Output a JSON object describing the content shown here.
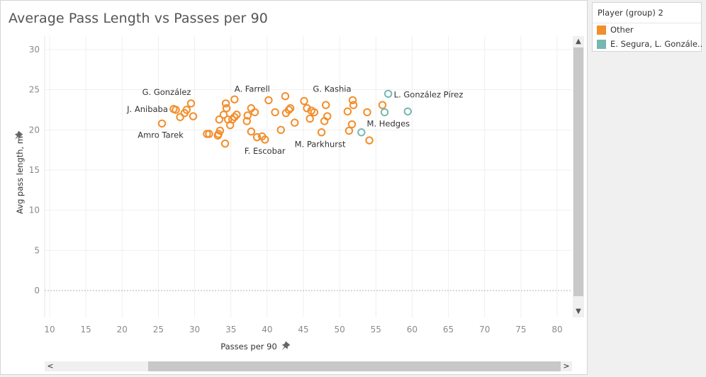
{
  "chart_data": {
    "type": "scatter",
    "title": "Average Pass Length vs Passes per 90",
    "xlabel": "Passes per 90",
    "ylabel": "Avg pass length, m",
    "xlim": [
      9,
      82
    ],
    "ylim": [
      -2,
      32
    ],
    "xticks": [
      10,
      15,
      20,
      25,
      30,
      35,
      40,
      45,
      50,
      55,
      60,
      65,
      70,
      75,
      80
    ],
    "yticks": [
      0,
      5,
      10,
      15,
      20,
      25,
      30
    ],
    "grid": true,
    "zero_line": "dotted",
    "legend": {
      "title": "Player (group) 2",
      "placement": "right",
      "entries": [
        {
          "name": "Other",
          "color": "#f28e2b"
        },
        {
          "name": "E. Segura, L. Gonzále..",
          "color": "#76b7b2"
        }
      ]
    },
    "series": [
      {
        "name": "Other",
        "color": "#f28e2b",
        "points": [
          {
            "x": 25.5,
            "y": 20.8,
            "label": "Amro Tarek"
          },
          {
            "x": 27.1,
            "y": 22.6
          },
          {
            "x": 27.4,
            "y": 22.5,
            "label": "J. Anibaba"
          },
          {
            "x": 28.0,
            "y": 21.6
          },
          {
            "x": 28.6,
            "y": 22.1
          },
          {
            "x": 28.9,
            "y": 22.5
          },
          {
            "x": 29.5,
            "y": 23.3,
            "label": "G. González"
          },
          {
            "x": 29.8,
            "y": 21.7
          },
          {
            "x": 31.7,
            "y": 19.5
          },
          {
            "x": 32.0,
            "y": 19.5
          },
          {
            "x": 33.2,
            "y": 19.3
          },
          {
            "x": 33.3,
            "y": 19.5
          },
          {
            "x": 33.5,
            "y": 19.9
          },
          {
            "x": 33.4,
            "y": 21.3
          },
          {
            "x": 34.0,
            "y": 21.9
          },
          {
            "x": 34.3,
            "y": 23.3
          },
          {
            "x": 34.4,
            "y": 22.7
          },
          {
            "x": 34.2,
            "y": 18.3
          },
          {
            "x": 34.6,
            "y": 21.3
          },
          {
            "x": 34.9,
            "y": 20.6
          },
          {
            "x": 35.2,
            "y": 21.3
          },
          {
            "x": 35.5,
            "y": 21.6
          },
          {
            "x": 35.8,
            "y": 21.9
          },
          {
            "x": 35.5,
            "y": 23.8,
            "label": "A. Farrell"
          },
          {
            "x": 37.2,
            "y": 21.1
          },
          {
            "x": 37.3,
            "y": 21.8
          },
          {
            "x": 37.8,
            "y": 22.7
          },
          {
            "x": 38.3,
            "y": 22.2
          },
          {
            "x": 37.8,
            "y": 19.8
          },
          {
            "x": 38.6,
            "y": 19.1
          },
          {
            "x": 39.3,
            "y": 19.2
          },
          {
            "x": 39.7,
            "y": 18.8,
            "label": "F. Escobar"
          },
          {
            "x": 40.2,
            "y": 23.7
          },
          {
            "x": 41.1,
            "y": 22.2
          },
          {
            "x": 41.9,
            "y": 20.0
          },
          {
            "x": 42.5,
            "y": 24.2
          },
          {
            "x": 42.6,
            "y": 22.1
          },
          {
            "x": 43.0,
            "y": 22.5
          },
          {
            "x": 43.2,
            "y": 22.7
          },
          {
            "x": 43.8,
            "y": 20.9
          },
          {
            "x": 45.1,
            "y": 23.6
          },
          {
            "x": 45.5,
            "y": 22.7
          },
          {
            "x": 45.9,
            "y": 21.4
          },
          {
            "x": 46.1,
            "y": 22.4
          },
          {
            "x": 46.5,
            "y": 22.2
          },
          {
            "x": 47.5,
            "y": 19.7,
            "label": "M. Parkhurst"
          },
          {
            "x": 47.9,
            "y": 21.1
          },
          {
            "x": 48.1,
            "y": 23.1
          },
          {
            "x": 48.3,
            "y": 21.7
          },
          {
            "x": 51.1,
            "y": 22.3
          },
          {
            "x": 51.3,
            "y": 19.9
          },
          {
            "x": 51.7,
            "y": 20.7
          },
          {
            "x": 51.8,
            "y": 23.7,
            "label": "G. Kashia"
          },
          {
            "x": 51.9,
            "y": 23.1
          },
          {
            "x": 53.8,
            "y": 22.2
          },
          {
            "x": 54.1,
            "y": 18.7
          },
          {
            "x": 55.9,
            "y": 23.1
          }
        ]
      },
      {
        "name": "E. Segura, L. Gonzále..",
        "color": "#76b7b2",
        "points": [
          {
            "x": 53.0,
            "y": 19.7,
            "label": "M. Hedges"
          },
          {
            "x": 56.2,
            "y": 22.2
          },
          {
            "x": 56.7,
            "y": 24.5,
            "label": "L. González Pírez"
          },
          {
            "x": 59.4,
            "y": 22.3
          }
        ]
      }
    ],
    "labels": [
      {
        "text": "G. González",
        "x": 29.5,
        "y": 23.3,
        "anchor": "upper-left"
      },
      {
        "text": "J. Anibaba",
        "x": 27.1,
        "y": 22.6,
        "anchor": "left"
      },
      {
        "text": "Amro Tarek",
        "x": 25.5,
        "y": 20.8,
        "anchor": "lower"
      },
      {
        "text": "A. Farrell",
        "x": 35.5,
        "y": 23.8,
        "anchor": "upper-right"
      },
      {
        "text": "F. Escobar",
        "x": 39.7,
        "y": 18.8,
        "anchor": "lower"
      },
      {
        "text": "G. Kashia",
        "x": 51.8,
        "y": 23.7,
        "anchor": "upper-left"
      },
      {
        "text": "M. Parkhurst",
        "x": 47.5,
        "y": 19.7,
        "anchor": "lower"
      },
      {
        "text": "L. González Pírez",
        "x": 56.7,
        "y": 24.5,
        "anchor": "right"
      },
      {
        "text": "M. Hedges",
        "x": 53.0,
        "y": 19.7,
        "anchor": "upper-right"
      }
    ]
  },
  "scrollbars": {
    "vertical": {
      "up": "^",
      "down": "v",
      "position": 0.0,
      "visible_fraction": 0.95
    },
    "horizontal": {
      "left": "<",
      "right": ">",
      "position": 1.0,
      "visible_fraction": 0.8
    }
  },
  "icons": {
    "x_pin": "pin-icon",
    "y_pin": "pin-icon"
  }
}
